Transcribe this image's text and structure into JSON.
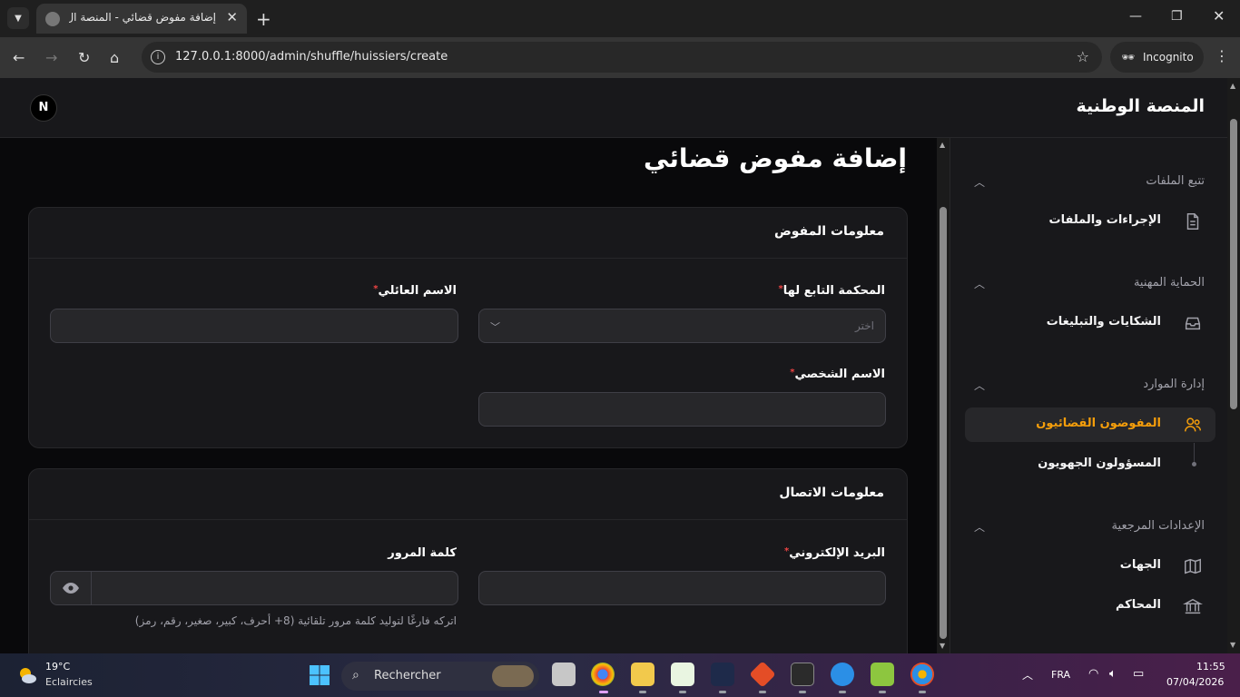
{
  "browser": {
    "tab_title": "إضافة مفوض قضائي - المنصة ال",
    "url": "127.0.0.1:8000/admin/shuffle/huissiers/create",
    "incognito_label": "Incognito"
  },
  "app": {
    "brand": "المنصة الوطنية",
    "avatar_initial": "N"
  },
  "sidebar": {
    "groups": [
      {
        "label": "تتبع الملفات",
        "items": [
          {
            "label": "الإجراءات والملفات",
            "icon": "document-icon"
          }
        ]
      },
      {
        "label": "الحماية المهنية",
        "items": [
          {
            "label": "الشكايات والتبليغات",
            "icon": "inbox-icon"
          }
        ]
      },
      {
        "label": "إدارة الموارد",
        "items": [
          {
            "label": "المفوضون القضائيون",
            "icon": "users-icon",
            "active": true
          },
          {
            "label": "المسؤولون الجهويون",
            "icon": "",
            "sub": true
          }
        ]
      },
      {
        "label": "الإعدادات المرجعية",
        "items": [
          {
            "label": "الجهات",
            "icon": "map-icon"
          },
          {
            "label": "المحاكم",
            "icon": "building-icon"
          }
        ]
      }
    ]
  },
  "main": {
    "page_title": "إضافة مفوض قضائي",
    "section_info": {
      "title": "معلومات المفوض",
      "court_label": "المحكمة التابع لها",
      "court_placeholder": "اختر",
      "family_name_label": "الاسم العائلي",
      "first_name_label": "الاسم الشخصي"
    },
    "section_contact": {
      "title": "معلومات الاتصال",
      "email_label": "البريد الإلكتروني",
      "password_label": "كلمة المرور",
      "password_hint": "اتركه فارغًا لتوليد كلمة مرور تلقائية (8+ أحرف، كبير، صغير، رقم، رمز)"
    },
    "required_mark": "*"
  },
  "taskbar": {
    "weather_temp": "19°C",
    "weather_desc": "Eclaircies",
    "search_label": "Rechercher",
    "lang": "FRA",
    "time": "11:55",
    "date": "07/04/2026"
  },
  "colors": {
    "accent": "#f59e0b",
    "required": "#ef4444"
  }
}
